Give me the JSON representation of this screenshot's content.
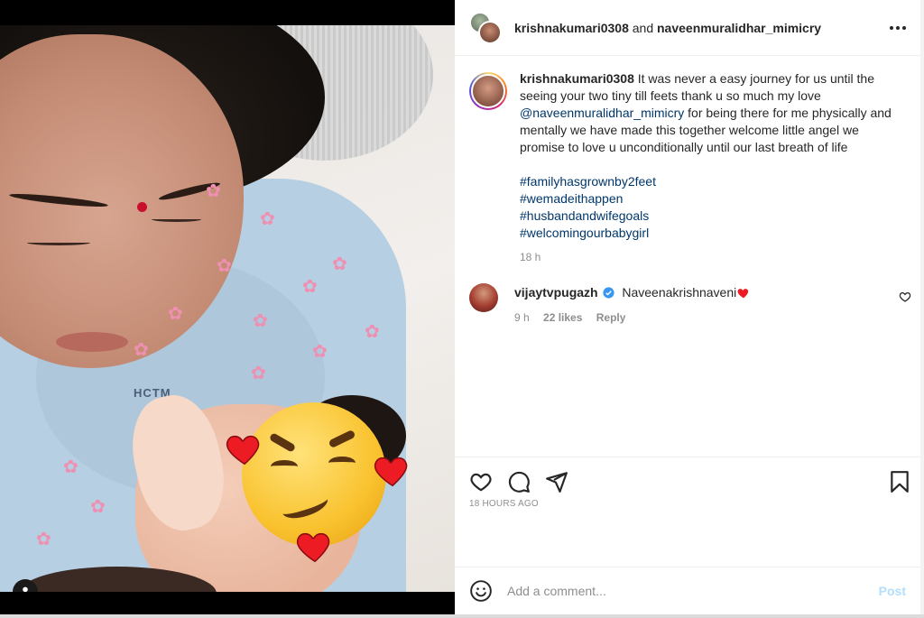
{
  "header": {
    "user1": "krishnakumari0308",
    "joiner": "and",
    "user2": "naveenmuralidhar_mimicry",
    "more_icon": "more-horizontal-icon"
  },
  "caption": {
    "username": "krishnakumari0308",
    "text_part1": "It was never a easy journey for us until the seeing your two tiny till feets thank u so much my love",
    "mention": "@naveenmuralidhar_mimicry",
    "text_part2": "for being there for me physically and mentally we have made this together welcome little angel we promise to love u unconditionally until our last breath of life",
    "hashtags": [
      "#familyhasgrownby2feet",
      "#wemadeithappen",
      "#husbandandwifegoals",
      "#welcomingourbabygirl"
    ],
    "time": "18 h"
  },
  "comment": {
    "username": "vijaytvpugazh",
    "verified": true,
    "text": "Naveenakrishnaveni",
    "time": "9 h",
    "likes": "22 likes",
    "reply": "Reply"
  },
  "actions": {
    "icons": [
      "heart-outline-icon",
      "comment-icon",
      "share-icon",
      "bookmark-icon"
    ],
    "timestamp": "18 HOURS AGO"
  },
  "add_comment": {
    "placeholder": "Add a comment...",
    "post_label": "Post",
    "emoji_icon": "smiley-icon"
  },
  "media": {
    "gown_text": "HCTM",
    "tag_icon": "user-tag-icon"
  },
  "colors": {
    "link": "#00376b",
    "muted": "#8e8e8e",
    "post_disabled": "#b2dffc",
    "verified": "#3897f0",
    "heart_red": "#ed1c24"
  }
}
